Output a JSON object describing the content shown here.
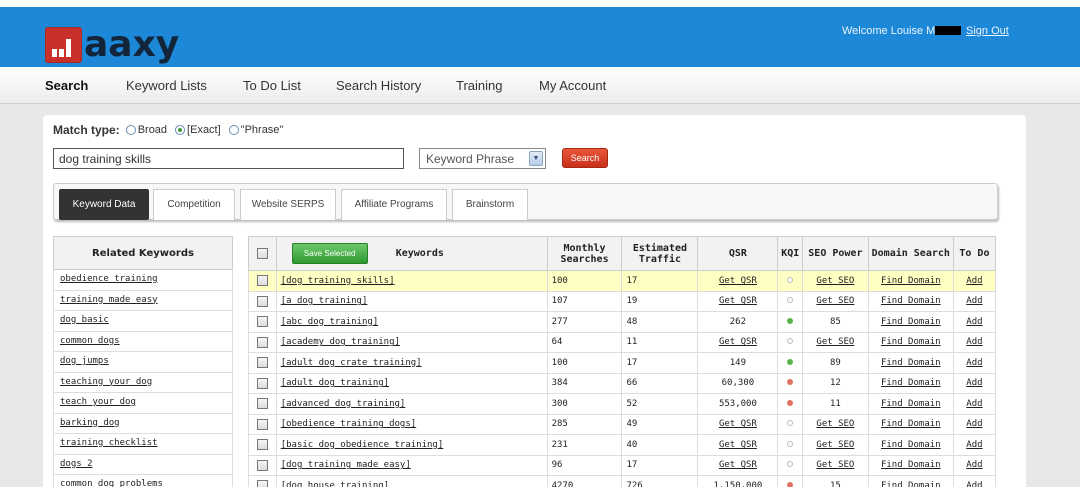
{
  "header": {
    "logo_text": "aaxy",
    "welcome": "Welcome Louise M",
    "sign_out": "Sign Out"
  },
  "nav": {
    "items": [
      "Search",
      "Keyword Lists",
      "To Do List",
      "Search History",
      "Training",
      "My Account"
    ],
    "active": "Search"
  },
  "search": {
    "match_type_label": "Match type:",
    "options": [
      "Broad",
      "[Exact]",
      "\"Phrase\""
    ],
    "selected_option": "[Exact]",
    "query": "dog training skills",
    "select_value": "Keyword Phrase",
    "button": "Search"
  },
  "tabs": [
    "Keyword Data",
    "Competition",
    "Website SERPS",
    "Affiliate Programs",
    "Brainstorm"
  ],
  "related": {
    "header": "Related Keywords",
    "items": [
      "obedience training",
      "training made easy",
      "dog basic",
      "common dogs",
      "dog jumps",
      "teaching your dog",
      "teach your dog",
      "barking dog",
      "training checklist",
      "dogs 2",
      "common dog problems"
    ]
  },
  "table": {
    "save_button": "Save Selected",
    "headers": {
      "keywords": "Keywords",
      "monthly_a": "Monthly",
      "monthly_b": "Searches",
      "traffic_a": "Estimated",
      "traffic_b": "Traffic",
      "qsr": "QSR",
      "kqi": "KQI",
      "seo": "SEO Power",
      "domain": "Domain Search",
      "todo": "To Do"
    },
    "rows": [
      {
        "keyword": "[dog training skills]",
        "monthly": "100",
        "traffic": "17",
        "qsr": "Get QSR",
        "kqi": "grey",
        "seo": "Get SEO",
        "domain": "Find Domain",
        "todo": "Add"
      },
      {
        "keyword": "[a dog training]",
        "monthly": "107",
        "traffic": "19",
        "qsr": "Get QSR",
        "kqi": "grey",
        "seo": "Get SEO",
        "domain": "Find Domain",
        "todo": "Add"
      },
      {
        "keyword": "[abc dog training]",
        "monthly": "277",
        "traffic": "48",
        "qsr": "262",
        "kqi": "green",
        "seo": "85",
        "domain": "Find Domain",
        "todo": "Add"
      },
      {
        "keyword": "[academy dog training]",
        "monthly": "64",
        "traffic": "11",
        "qsr": "Get QSR",
        "kqi": "grey",
        "seo": "Get SEO",
        "domain": "Find Domain",
        "todo": "Add"
      },
      {
        "keyword": "[adult dog crate training]",
        "monthly": "100",
        "traffic": "17",
        "qsr": "149",
        "kqi": "green",
        "seo": "89",
        "domain": "Find Domain",
        "todo": "Add"
      },
      {
        "keyword": "[adult dog training]",
        "monthly": "384",
        "traffic": "66",
        "qsr": "60,300",
        "kqi": "red",
        "seo": "12",
        "domain": "Find Domain",
        "todo": "Add"
      },
      {
        "keyword": "[advanced dog training]",
        "monthly": "300",
        "traffic": "52",
        "qsr": "553,000",
        "kqi": "red",
        "seo": "11",
        "domain": "Find Domain",
        "todo": "Add"
      },
      {
        "keyword": "[obedience training dogs]",
        "monthly": "285",
        "traffic": "49",
        "qsr": "Get QSR",
        "kqi": "grey",
        "seo": "Get SEO",
        "domain": "Find Domain",
        "todo": "Add"
      },
      {
        "keyword": "[basic dog obedience training]",
        "monthly": "231",
        "traffic": "40",
        "qsr": "Get QSR",
        "kqi": "grey",
        "seo": "Get SEO",
        "domain": "Find Domain",
        "todo": "Add"
      },
      {
        "keyword": "[dog training made easy]",
        "monthly": "96",
        "traffic": "17",
        "qsr": "Get QSR",
        "kqi": "grey",
        "seo": "Get SEO",
        "domain": "Find Domain",
        "todo": "Add"
      },
      {
        "keyword": "[dog house training]",
        "monthly": "4270",
        "traffic": "726",
        "qsr": "1,150,000",
        "kqi": "red",
        "seo": "15",
        "domain": "Find Domain",
        "todo": "Add"
      }
    ]
  },
  "colors": {
    "header_blue": "#1e88d8",
    "logo_red": "#c9302c",
    "save_green": "#2e9a2e",
    "search_red": "#c8301a",
    "highlight_row": "#ffffc4"
  }
}
